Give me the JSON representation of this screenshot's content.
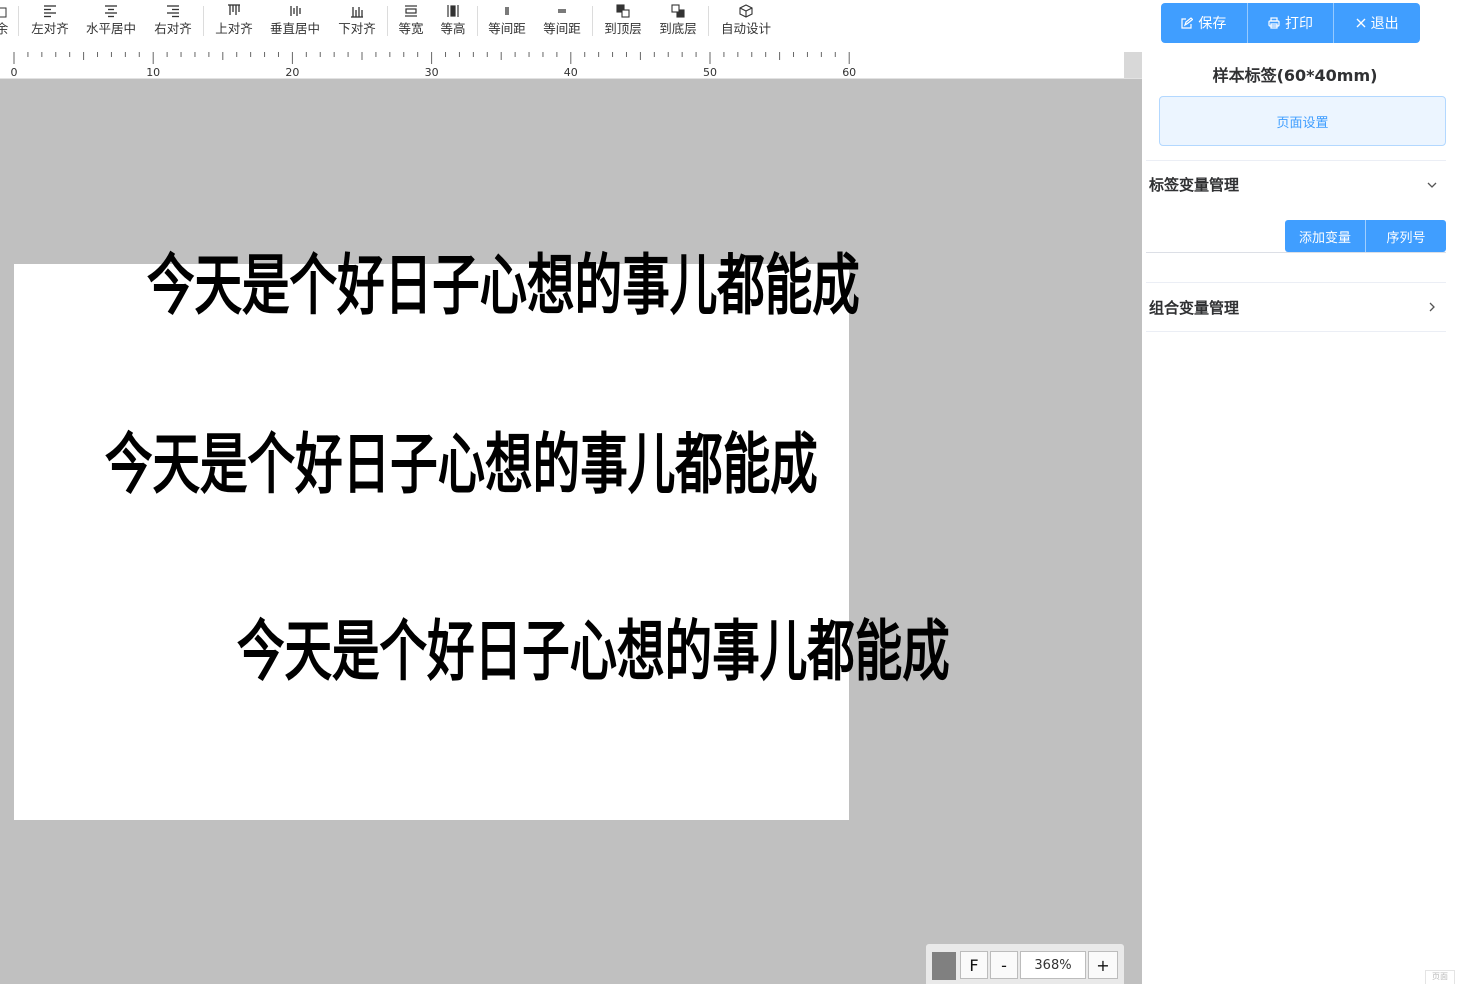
{
  "toolbar": {
    "items": [
      {
        "label": "余",
        "icon": "delete-icon"
      },
      {
        "label": "左对齐",
        "icon": "align-left-icon"
      },
      {
        "label": "水平居中",
        "icon": "align-center-icon"
      },
      {
        "label": "右对齐",
        "icon": "align-right-icon"
      },
      {
        "label": "上对齐",
        "icon": "align-top-icon"
      },
      {
        "label": "垂直居中",
        "icon": "align-middle-icon"
      },
      {
        "label": "下对齐",
        "icon": "align-bottom-icon"
      },
      {
        "label": "等宽",
        "icon": "same-width-icon"
      },
      {
        "label": "等高",
        "icon": "same-height-icon"
      },
      {
        "label": "等间距",
        "icon": "equal-spacing-h-icon"
      },
      {
        "label": "等间距",
        "icon": "equal-spacing-v-icon"
      },
      {
        "label": "到顶层",
        "icon": "bring-front-icon"
      },
      {
        "label": "到底层",
        "icon": "send-back-icon"
      },
      {
        "label": "自动设计",
        "icon": "cube-icon"
      }
    ]
  },
  "ruler": {
    "labels": [
      "0",
      "10",
      "20",
      "30",
      "40",
      "50",
      "60"
    ]
  },
  "canvas": {
    "texts": [
      "今天是个好日子心想的事儿都能成",
      "今天是个好日子心想的事儿都能成",
      "今天是个好日子心想的事儿都能成"
    ]
  },
  "zoom": {
    "fit_label": "F",
    "minus_label": "-",
    "value": "368%",
    "plus_label": "+",
    "swatch_color": "#808080"
  },
  "panel": {
    "actions": [
      {
        "label": "保存",
        "icon": "edit-icon"
      },
      {
        "label": "打印",
        "icon": "printer-icon"
      },
      {
        "label": "退出",
        "icon": "close-icon"
      }
    ],
    "title": "样本标签(60*40mm)",
    "page_setup_label": "页面设置",
    "label_vars": {
      "title": "标签变量管理",
      "add_label": "添加变量",
      "serial_label": "序列号"
    },
    "combo_vars": {
      "title": "组合变量管理"
    },
    "corner_label": "页面"
  },
  "colors": {
    "primary": "#409eff",
    "canvas_bg": "#c0c0c0",
    "primary_light": "#ecf5ff"
  }
}
